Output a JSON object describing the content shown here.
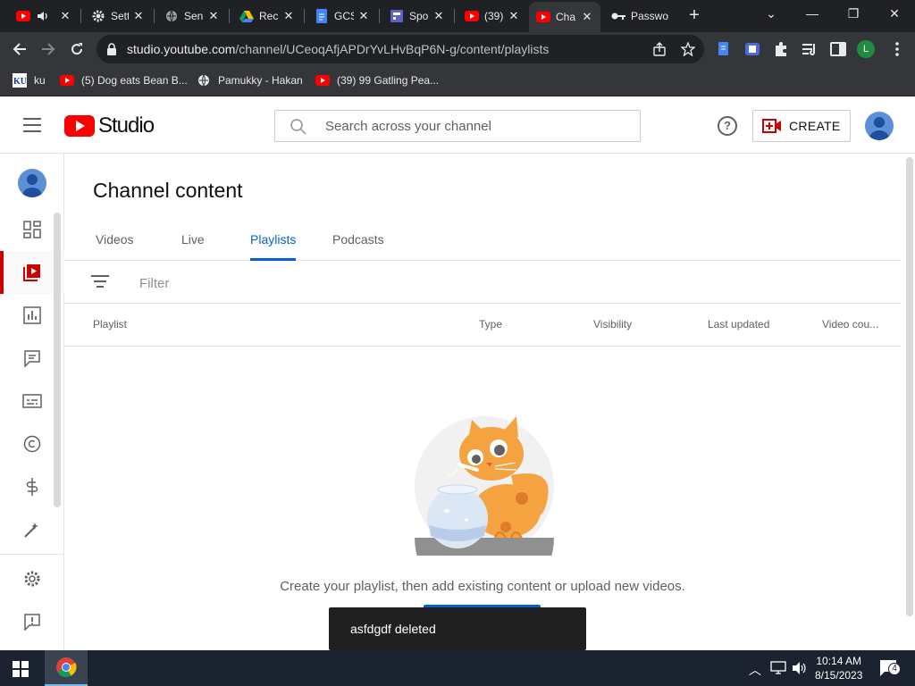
{
  "browser": {
    "tabs": [
      {
        "title": "",
        "icon": "youtube-icon"
      },
      {
        "title": "",
        "icon": "speaker-icon"
      },
      {
        "title": "Setti",
        "icon": "gear-icon"
      },
      {
        "title": "Sen",
        "icon": "globe-icon"
      },
      {
        "title": "Rec",
        "icon": "google-drive-icon"
      },
      {
        "title": "GCS",
        "icon": "google-docs-icon"
      },
      {
        "title": "Spo",
        "icon": "google-forms-icon"
      },
      {
        "title": "(39)",
        "icon": "youtube-icon"
      },
      {
        "title": "Cha",
        "icon": "youtube-icon",
        "active": true
      },
      {
        "title": "Passwor",
        "icon": "key-icon"
      }
    ],
    "url_host": "studio.youtube.com",
    "url_path": "/channel/UCeoqAfjAPDrYvLHvBqP6N-g/content/playlists",
    "profile_initial": "L",
    "bookmarks": [
      {
        "label": "ku",
        "icon": "ku-icon"
      },
      {
        "label": "(5) Dog eats Bean B...",
        "icon": "youtube-icon"
      },
      {
        "label": "Pamukky - Hakan",
        "icon": "globe-icon"
      },
      {
        "label": "(39) 99 Gatling Pea...",
        "icon": "youtube-icon"
      }
    ]
  },
  "header": {
    "logo_text": "Studio",
    "search_placeholder": "Search across your channel",
    "help_label": "?",
    "create_label": "CREATE"
  },
  "sidebar": {
    "items": [
      {
        "name": "dashboard-icon"
      },
      {
        "name": "content-icon",
        "active": true
      },
      {
        "name": "analytics-icon"
      },
      {
        "name": "comments-icon"
      },
      {
        "name": "subtitles-icon"
      },
      {
        "name": "copyright-icon"
      },
      {
        "name": "earn-icon"
      },
      {
        "name": "customization-icon"
      },
      {
        "name": "settings-icon"
      },
      {
        "name": "feedback-icon"
      }
    ]
  },
  "main": {
    "title": "Channel content",
    "tabs": [
      {
        "label": "Videos"
      },
      {
        "label": "Live"
      },
      {
        "label": "Playlists",
        "active": true
      },
      {
        "label": "Podcasts"
      }
    ],
    "filter_placeholder": "Filter",
    "columns": [
      "Playlist",
      "Type",
      "Visibility",
      "Last updated",
      "Video cou..."
    ],
    "empty_message": "Create your playlist, then add existing content or upload new videos."
  },
  "snackbar": {
    "text": "asfdgdf deleted"
  },
  "taskbar": {
    "time": "10:14 AM",
    "date": "8/15/2023",
    "notification_count": "4"
  },
  "colors": {
    "accent": "#065fd4",
    "brand_red": "#ff0000",
    "active_red": "#cc0000"
  }
}
